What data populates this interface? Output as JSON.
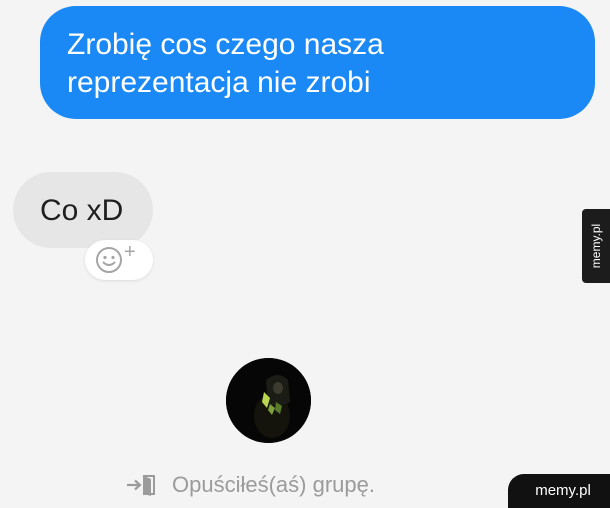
{
  "messages": {
    "outgoing": {
      "line1": "Zrobię cos czego nasza",
      "line2": "reprezentacja nie zrobi",
      "bubble_color": "#1a89f5"
    },
    "incoming": {
      "text": "Co xD",
      "bubble_color": "#e6e6e6"
    }
  },
  "reaction": {
    "icon": "smiley-icon",
    "plus": "+"
  },
  "group_event": {
    "icon": "exit-door-icon",
    "text": "Opuściłeś(aś) grupę."
  },
  "watermark": {
    "side": "memy.pl",
    "corner": "memy.pl"
  }
}
